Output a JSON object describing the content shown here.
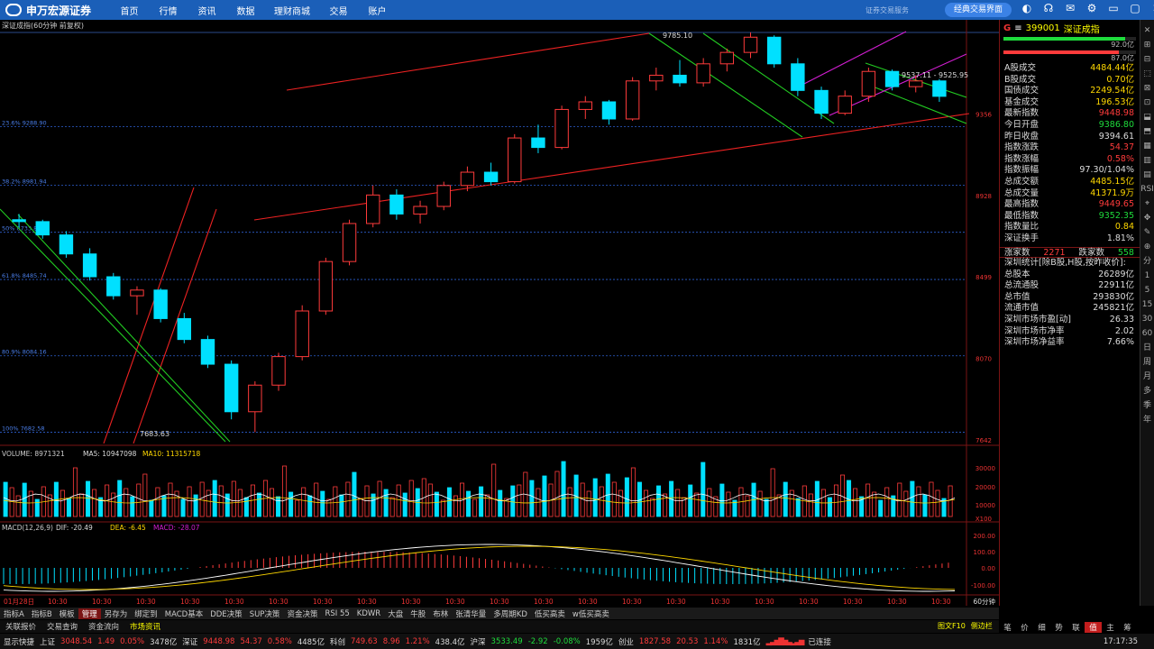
{
  "app": {
    "logo_text": "申万宏源证券",
    "menus": [
      "首页",
      "行情",
      "资讯",
      "数据",
      "理财商城",
      "交易",
      "账户"
    ],
    "slogan": "证券交易服务",
    "classic_button": "经典交易界面"
  },
  "chart": {
    "title": "深证成指(60分钟 前复权)",
    "price_axis": [
      "9356",
      "8928",
      "8499",
      "8070",
      "7642"
    ],
    "fib_labels": [
      "23.6% 9288.90",
      "38.2% 8981.94",
      "50% 8733.84",
      "61.8% 8485.74",
      "80.9% 8084.16",
      "100% 7682.58"
    ],
    "annotations": {
      "high": "9785.10",
      "low": "7683.63",
      "range": "9537.11 - 9525.95"
    },
    "volume_title": "VOLUME: 8971321",
    "ma5_label": "MA5: 10947098",
    "ma10_label": "MA10: 11315718",
    "volume_axis": [
      "30000",
      "20000",
      "10000",
      "X100"
    ],
    "macd_title": "MACD(12,26,9)",
    "dif_label": "DIF: -20.49",
    "dea_label": "DEA: -6.45",
    "macd_label": "MACD: -28.07",
    "macd_axis": [
      "200.00",
      "100.00",
      "0.00",
      "-100.00"
    ],
    "time_first": "01月28日",
    "time_tick": "10:30",
    "period_label": "60分钟"
  },
  "chart_data": {
    "type": "candlestick",
    "title": "深证成指(60分钟 前复权)",
    "y_range": [
      7642,
      9785
    ],
    "candles_ohlc": [
      [
        8800,
        8830,
        8760,
        8790
      ],
      [
        8790,
        8800,
        8700,
        8720
      ],
      [
        8720,
        8740,
        8600,
        8620
      ],
      [
        8620,
        8650,
        8480,
        8500
      ],
      [
        8500,
        8520,
        8380,
        8400
      ],
      [
        8400,
        8450,
        8300,
        8430
      ],
      [
        8430,
        8440,
        8260,
        8280
      ],
      [
        8280,
        8310,
        8150,
        8170
      ],
      [
        8170,
        8190,
        8020,
        8040
      ],
      [
        8040,
        8060,
        7750,
        7790
      ],
      [
        7790,
        7950,
        7683,
        7930
      ],
      [
        7930,
        8100,
        7900,
        8080
      ],
      [
        8080,
        8350,
        8060,
        8320
      ],
      [
        8320,
        8600,
        8300,
        8580
      ],
      [
        8580,
        8800,
        8560,
        8780
      ],
      [
        8780,
        8980,
        8760,
        8930
      ],
      [
        8930,
        8960,
        8800,
        8830
      ],
      [
        8830,
        8900,
        8780,
        8870
      ],
      [
        8870,
        9000,
        8850,
        8980
      ],
      [
        8980,
        9080,
        8950,
        9050
      ],
      [
        9050,
        9100,
        8980,
        9000
      ],
      [
        9000,
        9250,
        8990,
        9230
      ],
      [
        9230,
        9300,
        9150,
        9180
      ],
      [
        9180,
        9400,
        9170,
        9380
      ],
      [
        9380,
        9450,
        9330,
        9420
      ],
      [
        9420,
        9430,
        9300,
        9330
      ],
      [
        9330,
        9550,
        9320,
        9530
      ],
      [
        9530,
        9600,
        9480,
        9560
      ],
      [
        9560,
        9640,
        9500,
        9520
      ],
      [
        9520,
        9650,
        9500,
        9620
      ],
      [
        9620,
        9700,
        9580,
        9680
      ],
      [
        9680,
        9785,
        9650,
        9760
      ],
      [
        9760,
        9770,
        9600,
        9620
      ],
      [
        9620,
        9650,
        9450,
        9480
      ],
      [
        9480,
        9500,
        9330,
        9360
      ],
      [
        9360,
        9480,
        9350,
        9450
      ],
      [
        9450,
        9600,
        9420,
        9580
      ],
      [
        9580,
        9590,
        9480,
        9500
      ],
      [
        9500,
        9560,
        9470,
        9530
      ],
      [
        9530,
        9540,
        9420,
        9449
      ]
    ],
    "volume_ma5": 10947098,
    "volume_ma10": 11315718,
    "macd": {
      "dif": -20.49,
      "dea": -6.45,
      "macd": -28.07
    }
  },
  "right": {
    "code": "399001",
    "name": "深证成指",
    "top_bars": [
      "92.0亿",
      "87.0亿"
    ],
    "rows": [
      {
        "label": "A股成交",
        "value": "4484.44亿",
        "color": "yl"
      },
      {
        "label": "B股成交",
        "value": "0.70亿",
        "color": "yl"
      },
      {
        "label": "国债成交",
        "value": "2249.54亿",
        "color": "yl"
      },
      {
        "label": "基金成交",
        "value": "196.53亿",
        "color": "yl"
      },
      {
        "label": "最新指数",
        "value": "9448.98",
        "color": "up"
      },
      {
        "label": "今日开盘",
        "value": "9386.80",
        "color": "dn"
      },
      {
        "label": "昨日收盘",
        "value": "9394.61",
        "color": "wt"
      },
      {
        "label": "指数涨跌",
        "value": "54.37",
        "color": "up"
      },
      {
        "label": "指数涨幅",
        "value": "0.58%",
        "color": "up"
      },
      {
        "label": "指数振幅",
        "value": "97.30/1.04%",
        "color": "wt"
      },
      {
        "label": "总成交额",
        "value": "4485.15亿",
        "color": "yl"
      },
      {
        "label": "总成交量",
        "value": "41371.9万",
        "color": "yl"
      },
      {
        "label": "最高指数",
        "value": "9449.65",
        "color": "up"
      },
      {
        "label": "最低指数",
        "value": "9352.35",
        "color": "dn"
      },
      {
        "label": "指数量比",
        "value": "0.84",
        "color": "yl"
      },
      {
        "label": "深证换手",
        "value": "1.81%",
        "color": "wt"
      }
    ],
    "rise_label": "涨家数",
    "rise": "2271",
    "fall_label": "跌家数",
    "fall": "558",
    "stats_title": "深圳统计[除B股,H股,按昨收价]:",
    "stats": [
      {
        "label": "总股本",
        "value": "26289亿"
      },
      {
        "label": "总流通股",
        "value": "22911亿"
      },
      {
        "label": "总市值",
        "value": "293830亿"
      },
      {
        "label": "流通市值",
        "value": "245821亿"
      },
      {
        "label": "深圳市场市盈[动]",
        "value": "26.33"
      },
      {
        "label": "深圳市场市净率",
        "value": "2.02"
      },
      {
        "label": "深圳市场净益率",
        "value": "7.66%"
      }
    ],
    "bottom_tabs": [
      "笔",
      "价",
      "细",
      "势",
      "联",
      "值",
      "主",
      "筹"
    ],
    "selected_tab": "值"
  },
  "sidetools": [
    "✕",
    "⊞",
    "⊟",
    "⬚",
    "⊠",
    "⊡",
    "⬓",
    "⬒",
    "▦",
    "▥",
    "▤",
    "RSI",
    "⌖",
    "✥",
    "✎",
    "⊕",
    "分",
    "1",
    "5",
    "15",
    "30",
    "60",
    "日",
    "周",
    "月",
    "多",
    "季",
    "年"
  ],
  "indicator_tabs": [
    "指标A",
    "指标B",
    "模板",
    "管理",
    "另存为",
    "绑定到",
    "MACD基本",
    "DDE决策",
    "SUP决策",
    "资金决策",
    "RSI 55",
    "KDWR",
    "大盘",
    "牛股",
    "布林",
    "张清华量",
    "多周期KD",
    "低买高卖",
    "w低买高卖"
  ],
  "selected_indicator_tab": "管理",
  "bottom_tabs": [
    "关联报价",
    "交易查询",
    "资金流向",
    "市场资讯"
  ],
  "bottom_right": [
    "图文F10",
    "侧边栏"
  ],
  "status": {
    "show_label": "显示快捷",
    "sh_label": "上证",
    "sh_val": "3048.54",
    "sh_chg": "1.49",
    "sh_pct": "0.05%",
    "sh_amt": "3478亿",
    "sz_label": "深证",
    "sz_val": "9448.98",
    "sz_chg": "54.37",
    "sz_pct": "0.58%",
    "sz_amt": "4485亿",
    "kc_label": "科创",
    "kc_val": "749.63",
    "kc_chg": "8.96",
    "kc_pct": "1.21%",
    "kc_amt": "438.4亿",
    "hs_label": "沪深",
    "hs_val": "3533.49",
    "hs_chg": "-2.92",
    "hs_pct": "-0.08%",
    "hs_amt": "1959亿",
    "cy_label": "创业",
    "cy_val": "1827.58",
    "cy_chg": "20.53",
    "cy_pct": "1.14%",
    "cy_amt": "1831亿",
    "conn": "已连接",
    "time": "17:17:35"
  }
}
